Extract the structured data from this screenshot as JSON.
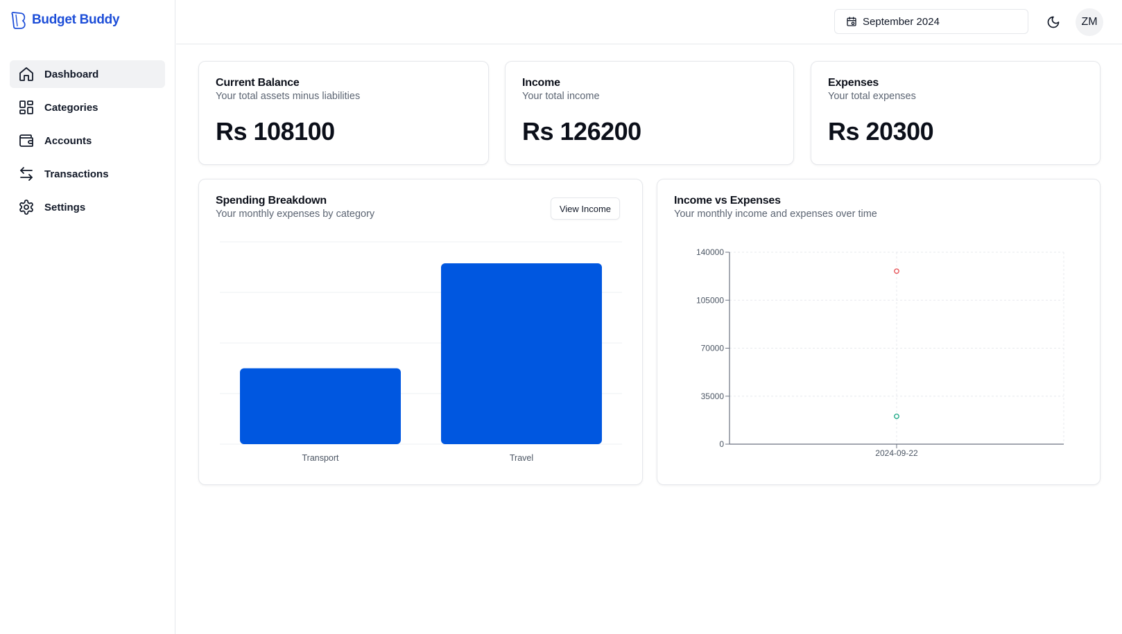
{
  "brand": {
    "name": "Budget Buddy",
    "color": "#1d4ed8"
  },
  "sidebar": {
    "items": [
      {
        "label": "Dashboard",
        "icon": "home-icon",
        "active": true
      },
      {
        "label": "Categories",
        "icon": "grid-icon",
        "active": false
      },
      {
        "label": "Accounts",
        "icon": "wallet-icon",
        "active": false
      },
      {
        "label": "Transactions",
        "icon": "arrows-left-right-icon",
        "active": false
      },
      {
        "label": "Settings",
        "icon": "gear-icon",
        "active": false
      }
    ]
  },
  "header": {
    "month_picker": {
      "value": "September 2024",
      "icon": "calendar-icon"
    },
    "theme_toggle_icon": "moon-icon",
    "avatar_initials": "ZM"
  },
  "stats": [
    {
      "title": "Current Balance",
      "subtitle": "Your total assets minus liabilities",
      "value": "Rs 108100"
    },
    {
      "title": "Income",
      "subtitle": "Your total income",
      "value": "Rs 126200"
    },
    {
      "title": "Expenses",
      "subtitle": "Your total expenses",
      "value": "Rs 20300"
    }
  ],
  "spending": {
    "title": "Spending Breakdown",
    "subtitle": "Your monthly expenses by category",
    "toggle_label": "View Income"
  },
  "trend": {
    "title": "Income vs Expenses",
    "subtitle": "Your monthly income and expenses over time"
  },
  "colors": {
    "bar": "#0057e0",
    "income_point": "#e5484d",
    "expense_point": "#10a37f",
    "axis": "#6b7280",
    "grid": "#eef0f3"
  },
  "chart_data": [
    {
      "type": "bar",
      "categories": [
        "Transport",
        "Travel"
      ],
      "values": [
        6000,
        14300
      ],
      "ylim": [
        0,
        16000
      ],
      "grid": true
    },
    {
      "type": "scatter",
      "x": [
        "2024-09-22"
      ],
      "series": [
        {
          "values": [
            126200
          ]
        },
        {
          "values": [
            20300
          ]
        }
      ],
      "yticks": [
        "0",
        "35000",
        "70000",
        "105000",
        "140000"
      ],
      "ylim": [
        0,
        140000
      ],
      "grid": true
    }
  ]
}
